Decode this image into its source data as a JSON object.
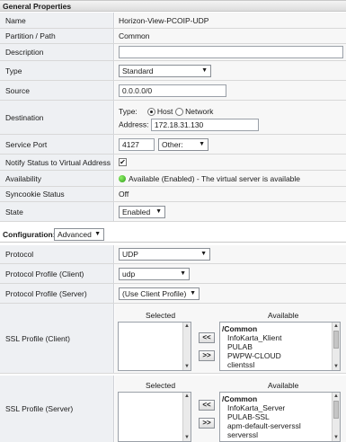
{
  "general": {
    "header": "General Properties",
    "name": {
      "label": "Name",
      "value": "Horizon-View-PCOIP-UDP"
    },
    "partition": {
      "label": "Partition / Path",
      "value": "Common"
    },
    "description": {
      "label": "Description",
      "value": ""
    },
    "type": {
      "label": "Type",
      "value": "Standard"
    },
    "source": {
      "label": "Source",
      "value": "0.0.0.0/0"
    },
    "destination": {
      "label": "Destination",
      "type_label": "Type:",
      "host_label": "Host",
      "network_label": "Network",
      "selected": "Host",
      "address_label": "Address:",
      "address_value": "172.18.31.130"
    },
    "service_port": {
      "label": "Service Port",
      "value": "4127",
      "select": "Other:"
    },
    "notify": {
      "label": "Notify Status to Virtual Address",
      "checked": true
    },
    "availability": {
      "label": "Availability",
      "value": "Available (Enabled) - The virtual server is available",
      "status_color": "#2f9d15"
    },
    "syncookie": {
      "label": "Syncookie Status",
      "value": "Off"
    },
    "state": {
      "label": "State",
      "value": "Enabled"
    }
  },
  "configuration": {
    "label": "Configuration:",
    "mode": "Advanced",
    "protocol": {
      "label": "Protocol",
      "value": "UDP"
    },
    "profile_client": {
      "label": "Protocol Profile (Client)",
      "value": "udp"
    },
    "profile_server": {
      "label": "Protocol Profile (Server)",
      "value": "(Use Client Profile)"
    },
    "ssl_client": {
      "label": "SSL Profile (Client)",
      "selected_header": "Selected",
      "available_header": "Available",
      "add_label": "<<",
      "remove_label": ">>",
      "available": [
        "/Common",
        "InfoKarta_Klient",
        "PULAB",
        "PWPW-CLOUD",
        "clientssl"
      ]
    },
    "ssl_server": {
      "label": "SSL Profile (Server)",
      "selected_header": "Selected",
      "available_header": "Available",
      "add_label": "<<",
      "remove_label": ">>",
      "available": [
        "/Common",
        "InfoKarta_Server",
        "PULAB-SSL",
        "apm-default-serverssl",
        "serverssl"
      ]
    }
  },
  "icons": {
    "dropdown_arrow": "▼",
    "check": "✔",
    "scroll_up": "▲",
    "scroll_down": "▼"
  }
}
